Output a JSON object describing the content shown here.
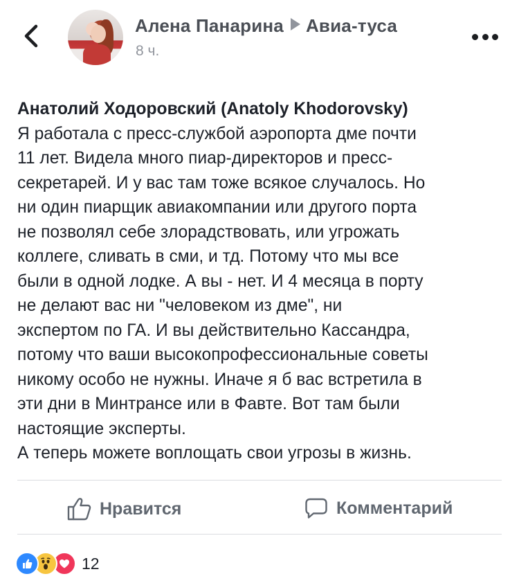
{
  "header": {
    "author": "Алена Панарина",
    "group": "Авиа-туса",
    "time": "8 ч."
  },
  "post": {
    "lines": [
      "Анатолий Ходоровский (Anatoly Khodorovsky)",
      "Я работала с пресс-службой аэропорта дме почти",
      "11 лет. Видела много пиар-директоров и пресс-",
      "секретарей. И у вас там тоже всякое случалось. Но",
      "ни один пиарщик авиакомпании или другого порта",
      "не позволял себе злорадствовать, или угрожать",
      "коллеге, сливать в сми, и тд. Потому что мы все",
      "были в одной лодке. А вы - нет. И 4 месяца в порту",
      "не делают вас ни \"человеком из дме\", ни",
      "экспертом по ГА. И вы действительно Кассандра,",
      "потому что ваши высокопрофессиональные советы",
      "никому особо не нужны. Иначе я б вас встретила в",
      "эти дни в Минтрансе или в Фавте. Вот там были",
      "настоящие эксперты.",
      "А теперь можете воплощать свои угрозы в жизнь."
    ]
  },
  "actions": {
    "like_label": "Нравится",
    "comment_label": "Комментарий"
  },
  "reactions": {
    "types": [
      "like",
      "wow",
      "love"
    ],
    "count": "12"
  },
  "colors": {
    "text": "#1d2129",
    "secondary": "#606770",
    "like_blue": "#2e89ff",
    "wow_yellow": "#f7c540",
    "love_red": "#f0365a"
  }
}
